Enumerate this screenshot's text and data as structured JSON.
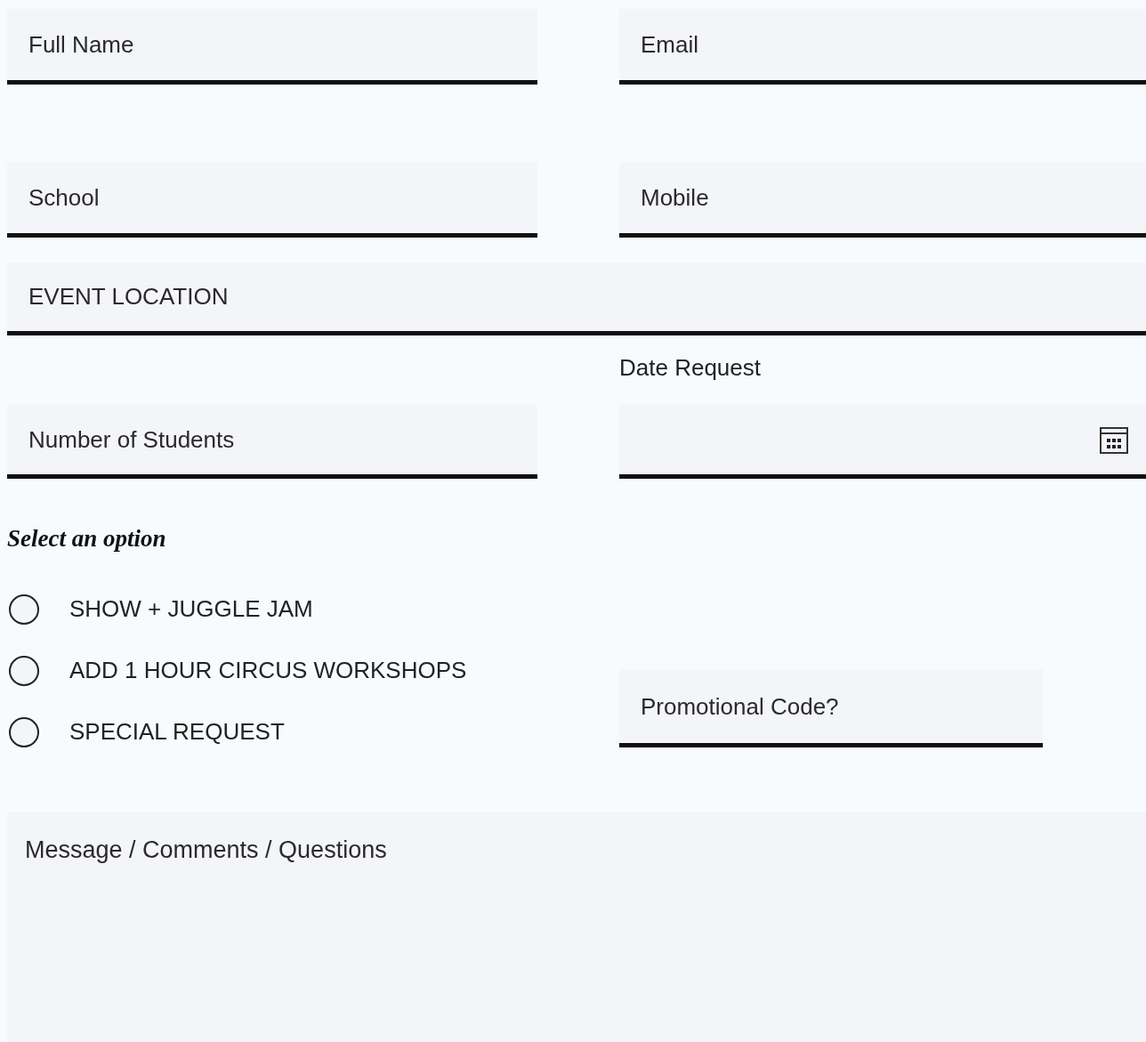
{
  "fields": [
    {
      "placeholder": "Full Name"
    },
    {
      "placeholder": "Email"
    },
    {
      "placeholder": "School"
    },
    {
      "placeholder": "Mobile"
    },
    {
      "placeholder": "EVENT LOCATION"
    }
  ],
  "students": {
    "placeholder": "Number of Students"
  },
  "date": {
    "label": "Date Request"
  },
  "options": {
    "heading": "Select an option",
    "items": [
      {
        "label": "SHOW + JUGGLE JAM",
        "selected": false
      },
      {
        "label": "ADD 1 HOUR CIRCUS WORKSHOPS",
        "selected": false
      },
      {
        "label": "SPECIAL REQUEST",
        "selected": false
      }
    ]
  },
  "promo": {
    "placeholder": "Promotional Code?"
  },
  "message": {
    "placeholder": "Message / Comments / Questions"
  }
}
